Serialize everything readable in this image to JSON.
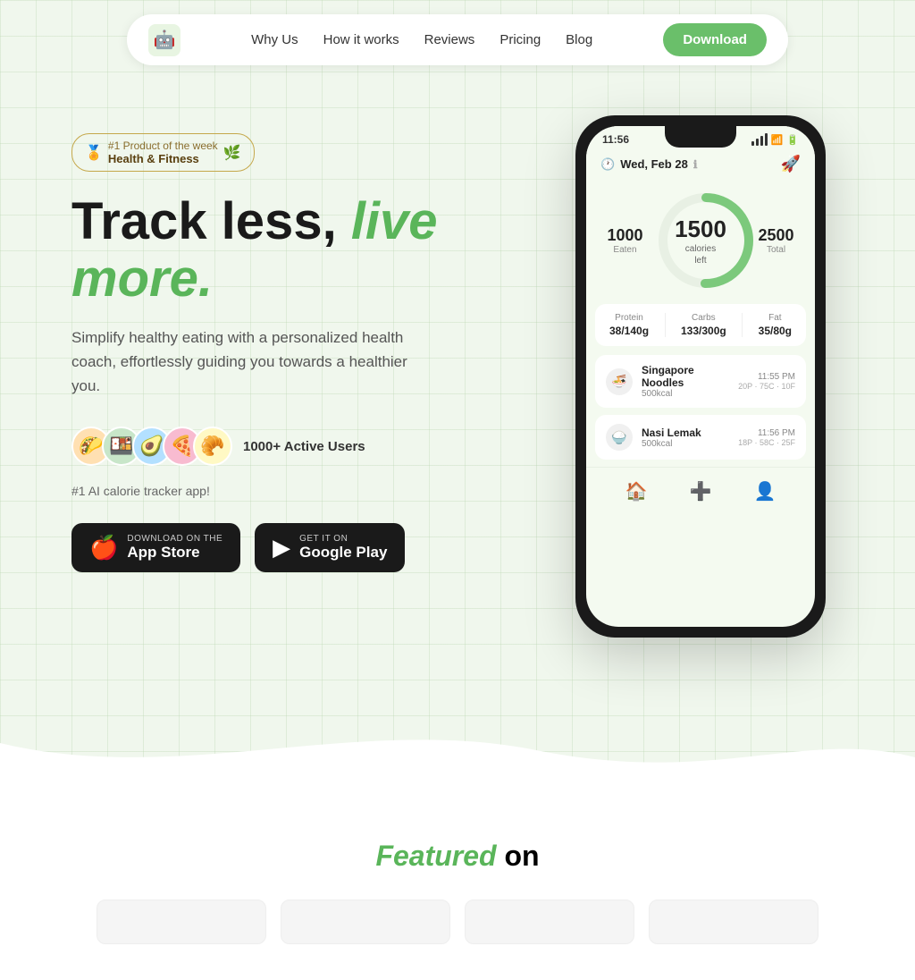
{
  "navbar": {
    "logo_emoji": "🤖",
    "links": [
      {
        "id": "why-us",
        "label": "Why Us"
      },
      {
        "id": "how-it-works",
        "label": "How it works"
      },
      {
        "id": "reviews",
        "label": "Reviews"
      },
      {
        "id": "pricing",
        "label": "Pricing"
      },
      {
        "id": "blog",
        "label": "Blog"
      }
    ],
    "download_btn": "Download"
  },
  "hero": {
    "badge": {
      "rank": "#1 Product of the week",
      "category": "Health & Fitness"
    },
    "heading_black": "Track less,",
    "heading_green": "live more.",
    "description": "Simplify healthy eating with a personalized health coach, effortlessly guiding you towards a healthier you.",
    "active_users": "1000+ Active Users",
    "tagline": "#1 AI calorie tracker app!",
    "app_store_label_small": "Download on the",
    "app_store_label_big": "App Store",
    "google_play_label_small": "GET IT ON",
    "google_play_label_big": "Google Play"
  },
  "phone": {
    "time": "11:56",
    "date": "Wed, Feb 28",
    "calories_eaten": "1000",
    "calories_eaten_label": "Eaten",
    "calories_left": "1500",
    "calories_left_label": "calories\nleft",
    "calories_total": "2500",
    "calories_total_label": "Total",
    "macros": [
      {
        "label": "Protein",
        "value": "38/140g"
      },
      {
        "label": "Carbs",
        "value": "133/300g"
      },
      {
        "label": "Fat",
        "value": "35/80g"
      }
    ],
    "meals": [
      {
        "name": "Singapore Noodles",
        "kcal": "500kcal",
        "time": "11:55 PM",
        "macros": "20P · 75C · 10F",
        "emoji": "🍜"
      },
      {
        "name": "Nasi Lemak",
        "kcal": "500kcal",
        "time": "11:56 PM",
        "macros": "18P · 58C · 25F",
        "emoji": "🍚"
      }
    ]
  },
  "featured": {
    "heading_green": "Featured",
    "heading_black": "on",
    "logos": [
      "",
      "",
      "",
      ""
    ]
  },
  "avatars": [
    "🌮",
    "🍱",
    "🥑",
    "🍕",
    "🥐"
  ]
}
